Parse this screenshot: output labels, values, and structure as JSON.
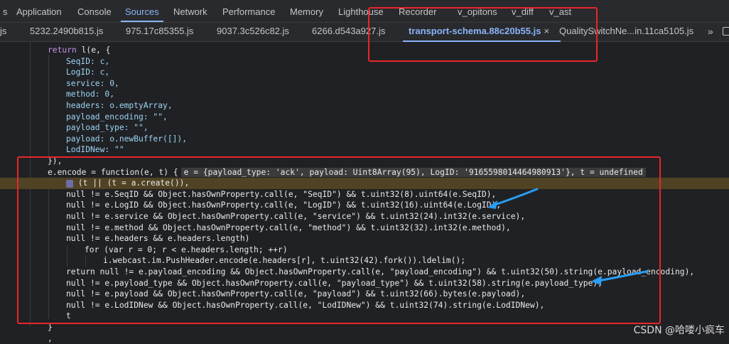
{
  "panel_tabs": [
    "Application",
    "Console",
    "Sources",
    "Network",
    "Performance",
    "Memory",
    "Lighthouse",
    "Recorder",
    "v_opitons",
    "v_diff",
    "v_ast"
  ],
  "active_panel_tab": "Sources",
  "file_tabs": [
    "js",
    "5232.2490b815.js",
    "975.17c85355.js",
    "9037.3c526c82.js",
    "6266.d543a927.js",
    "transport-schema.88c20b55.js",
    "QualitySwitchNe...in.11ca5105.js"
  ],
  "active_file_tab": "transport-schema.88c20b55.js",
  "close_glyph": "×",
  "more_tabs_glyph": "»",
  "watermark": "CSDN @哈喽小疯车",
  "inline_value": "e = {payload_type: 'ack', payload: Uint8Array(95), LogID: '9165598014464980913'}, t = undefined",
  "code": {
    "l1": "return l(e, {",
    "l2": "SeqID: c,",
    "l3": "LogID: c,",
    "l4": "service: 0,",
    "l5": "method: 0,",
    "l6": "headers: o.emptyArray,",
    "l7": "payload_encoding: \"\",",
    "l8": "payload_type: \"\",",
    "l9": "payload: o.newBuffer([]),",
    "l10": "LodIDNew: \"\"",
    "l11": "}),",
    "l12": "e.encode = function(e, t) {",
    "l13": "(t || (t = a.create()),",
    "l14": "null != e.SeqID && Object.hasOwnProperty.call(e, \"SeqID\") && t.uint32(8).uint64(e.SeqID),",
    "l15": "null != e.LogID && Object.hasOwnProperty.call(e, \"LogID\") && t.uint32(16).uint64(e.LogID),",
    "l16": "null != e.service && Object.hasOwnProperty.call(e, \"service\") && t.uint32(24).int32(e.service),",
    "l17": "null != e.method && Object.hasOwnProperty.call(e, \"method\") && t.uint32(32).int32(e.method),",
    "l18": "null != e.headers && e.headers.length)",
    "l19": "for (var r = 0; r < e.headers.length; ++r)",
    "l20": "i.webcast.im.PushHeader.encode(e.headers[r], t.uint32(42).fork()).ldelim();",
    "l21": "return null != e.payload_encoding && Object.hasOwnProperty.call(e, \"payload_encoding\") && t.uint32(50).string(e.payload_encoding),",
    "l22": "null != e.payload_type && Object.hasOwnProperty.call(e, \"payload_type\") && t.uint32(58).string(e.payload_type),",
    "l23": "null != e.payload && Object.hasOwnProperty.call(e, \"payload\") && t.uint32(66).bytes(e.payload),",
    "l24": "null != e.LodIDNew && Object.hasOwnProperty.call(e, \"LodIDNew\") && t.uint32(74).string(e.LodIDNew),",
    "l25": "t",
    "l26": "}",
    "l27": ","
  },
  "colors": {
    "annotation_red": "#e8262c",
    "annotation_arrow_blue": "#2a9df4",
    "active_tab_blue": "#8ab4f8",
    "paused_line_bg": "#504323"
  }
}
